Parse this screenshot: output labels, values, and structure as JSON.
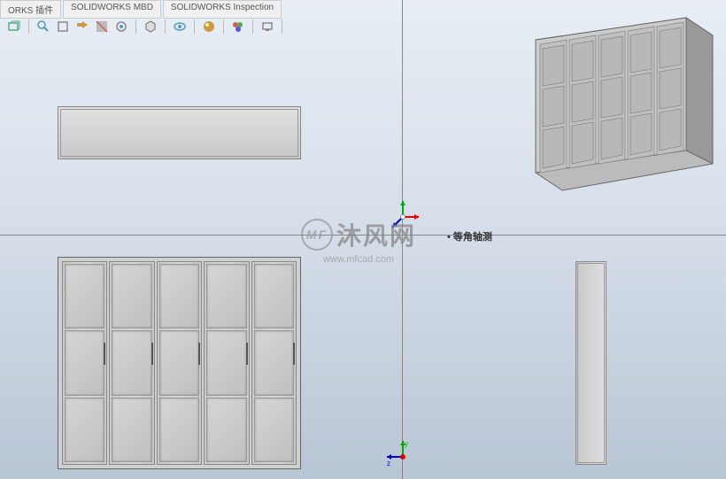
{
  "tabs": {
    "t1": "ORKS 插件",
    "t2": "SOLIDWORKS MBD",
    "t3": "SOLIDWORKS Inspection"
  },
  "toolbar": {
    "icons": {
      "orient": "orientation-icon",
      "zoom": "zoom-icon",
      "section": "section-icon",
      "display": "display-style-icon",
      "hide": "hide-show-icon",
      "scene": "apply-scene-icon",
      "settings": "view-settings-icon",
      "render": "render-icon"
    }
  },
  "views": {
    "iso_label": "等角轴测"
  },
  "watermark": {
    "text": "沐风网",
    "url": "www.mfcad.com",
    "logo": "MF"
  },
  "axes": {
    "x": "x",
    "y": "y",
    "z": "z"
  }
}
